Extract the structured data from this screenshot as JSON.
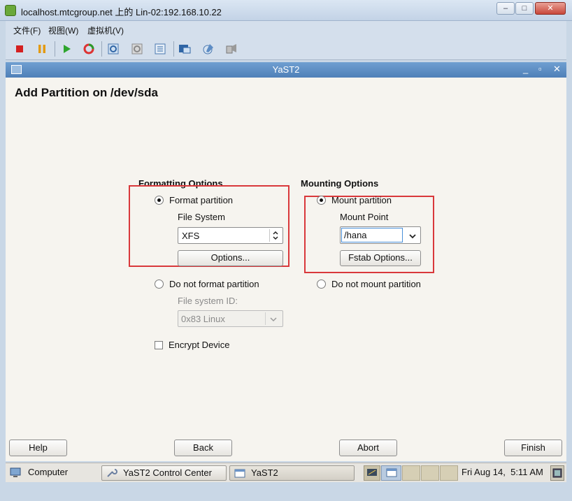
{
  "outer_window": {
    "title": "localhost.mtcgroup.net 上的 Lin-02:192.168.10.22",
    "controls": [
      "–",
      "□",
      "✕"
    ]
  },
  "menubar": {
    "items": [
      "文件(F)",
      "视图(W)",
      "虚拟机(V)"
    ]
  },
  "toolbar": {
    "icons": [
      "power-off-icon",
      "pause-icon",
      "power-on-icon",
      "reset-icon",
      "snapshot-icon",
      "revert-snapshot-icon",
      "snapshot-manager-icon",
      "console-icon",
      "edit-settings-icon",
      "devices-icon"
    ]
  },
  "yast_window": {
    "title": "YaST2",
    "controls": [
      "_",
      "▫",
      "✕"
    ],
    "page_title": "Add Partition on /dev/sda"
  },
  "formatting": {
    "title": "Formatting Options",
    "format_label": "Format partition",
    "format_selected": true,
    "file_system_label": "File System",
    "file_system_value": "XFS",
    "options_button": "Options...",
    "no_format_label": "Do not format partition",
    "fs_id_label": "File system ID:",
    "fs_id_value": "0x83 Linux",
    "encrypt_label": "Encrypt Device",
    "encrypt_checked": false
  },
  "mounting": {
    "title": "Mounting Options",
    "mount_label": "Mount partition",
    "mount_selected": true,
    "mount_point_label": "Mount Point",
    "mount_point_value": "/hana",
    "fstab_button": "Fstab Options...",
    "no_mount_label": "Do not mount partition"
  },
  "bottom_buttons": {
    "help": "Help",
    "back": "Back",
    "abort": "Abort",
    "finish": "Finish"
  },
  "taskbar": {
    "computer": "Computer",
    "tasks": [
      "YaST2 Control Center",
      "YaST2"
    ],
    "clock": "Fri Aug 14,  5:11 AM"
  },
  "colors": {
    "highlight_red": "#d9383b",
    "yast_title": "#5a8bc3"
  }
}
